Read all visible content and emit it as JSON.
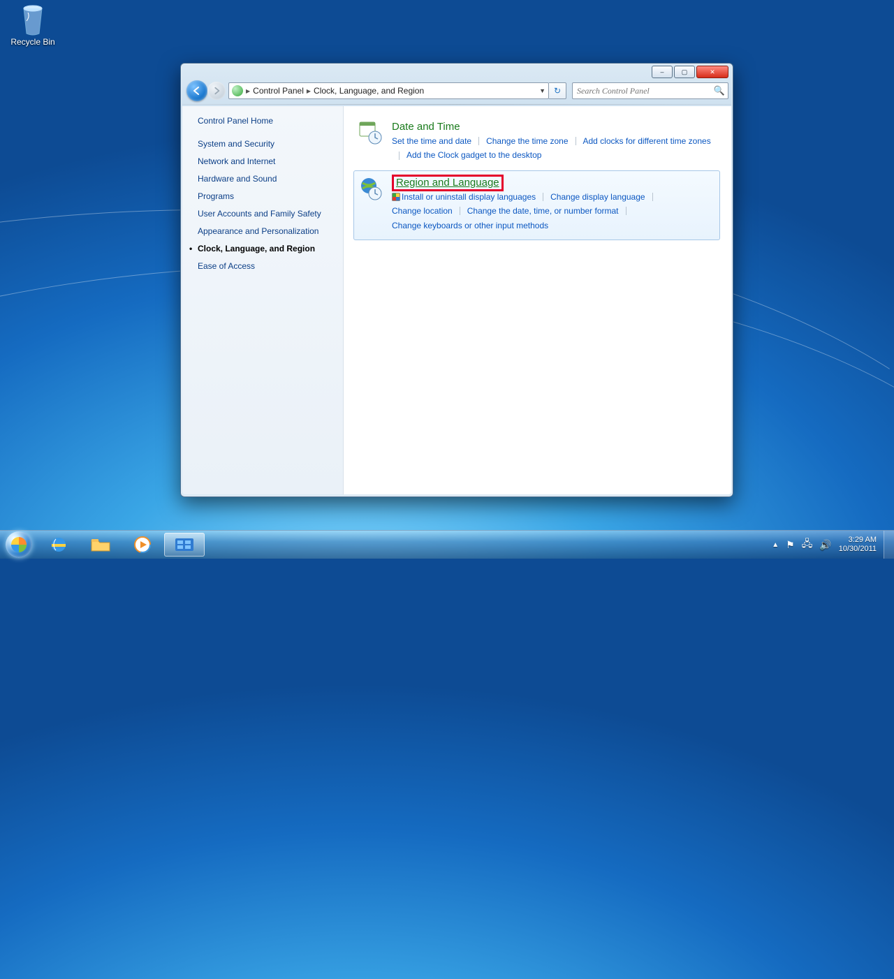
{
  "desktop": {
    "recycle_bin": "Recycle Bin"
  },
  "window": {
    "controls": {
      "min": "–",
      "max": "▢",
      "close": "✕"
    },
    "breadcrumb": {
      "root_icon": "control-panel",
      "level1": "Control Panel",
      "level2": "Clock, Language, and Region"
    },
    "refresh_glyph": "↻",
    "search": {
      "placeholder": "Search Control Panel"
    },
    "sidebar": {
      "home": "Control Panel Home",
      "items": [
        "System and Security",
        "Network and Internet",
        "Hardware and Sound",
        "Programs",
        "User Accounts and Family Safety",
        "Appearance and Personalization",
        "Clock, Language, and Region",
        "Ease of Access"
      ]
    },
    "categories": [
      {
        "title": "Date and Time",
        "tasks": [
          {
            "label": "Set the time and date"
          },
          {
            "label": "Change the time zone"
          },
          {
            "label": "Add clocks for different time zones"
          },
          {
            "label": "Add the Clock gadget to the desktop"
          }
        ]
      },
      {
        "title": "Region and Language",
        "highlighted": true,
        "tasks": [
          {
            "label": "Install or uninstall display languages",
            "shield": true
          },
          {
            "label": "Change display language"
          },
          {
            "label": "Change location"
          },
          {
            "label": "Change the date, time, or number format"
          },
          {
            "label": "Change keyboards or other input methods"
          }
        ]
      }
    ]
  },
  "taskbar": {
    "tray": {
      "time": "3:29 AM",
      "date": "10/30/2011"
    }
  }
}
